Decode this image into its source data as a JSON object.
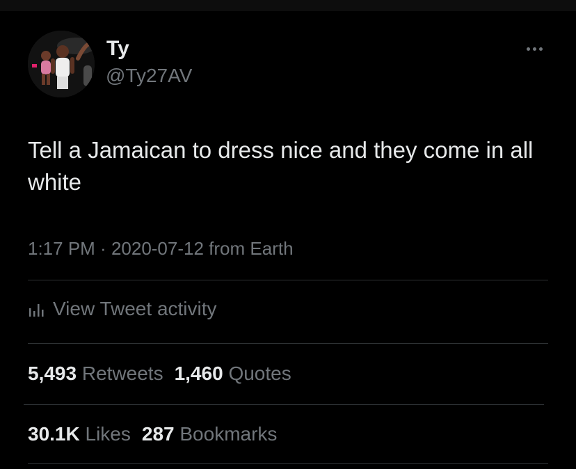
{
  "colors": {
    "background": "#000000",
    "primary_text": "#e7e9ea",
    "secondary_text": "#71767b",
    "divider": "#2f3336"
  },
  "author": {
    "display_name": "Ty",
    "handle": "@Ty27AV"
  },
  "tweet": {
    "text": "Tell a Jamaican to dress nice and they come in all white"
  },
  "meta": {
    "time": "1:17 PM",
    "separator": " · ",
    "date": "2020-07-12",
    "source": " from Earth"
  },
  "activity": {
    "icon": "bar-chart-icon",
    "label": "View Tweet activity"
  },
  "stats": {
    "retweets": {
      "count": "5,493",
      "label": "Retweets"
    },
    "quotes": {
      "count": "1,460",
      "label": "Quotes"
    },
    "likes": {
      "count": "30.1K",
      "label": "Likes"
    },
    "bookmarks": {
      "count": "287",
      "label": "Bookmarks"
    }
  }
}
